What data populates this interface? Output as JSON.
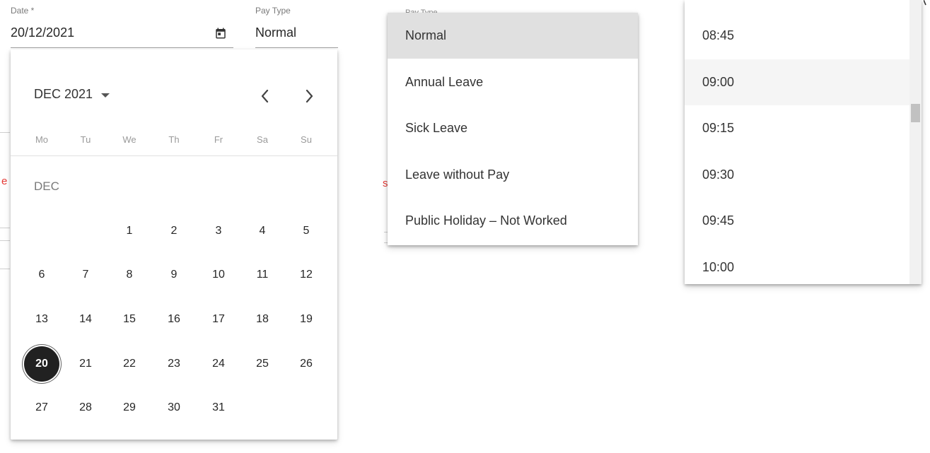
{
  "date_field": {
    "label": "Date *",
    "value": "20/12/2021"
  },
  "pay_type_field": {
    "label": "Pay Type",
    "value": "Normal"
  },
  "background_marks": {
    "left_red": "e",
    "mid_red": "s"
  },
  "calendar": {
    "month_year": "DEC 2021",
    "month_label": "DEC",
    "weekdays": [
      "Mo",
      "Tu",
      "We",
      "Th",
      "Fr",
      "Sa",
      "Su"
    ],
    "weeks": [
      [
        "",
        "",
        "1",
        "2",
        "3",
        "4",
        "5"
      ],
      [
        "6",
        "7",
        "8",
        "9",
        "10",
        "11",
        "12"
      ],
      [
        "13",
        "14",
        "15",
        "16",
        "17",
        "18",
        "19"
      ],
      [
        "20",
        "21",
        "22",
        "23",
        "24",
        "25",
        "26"
      ],
      [
        "27",
        "28",
        "29",
        "30",
        "31",
        "",
        ""
      ]
    ],
    "selected_day": "20",
    "prev_icon": "chevron-left-icon",
    "next_icon": "chevron-right-icon",
    "dropdown_icon": "triangle-down-icon"
  },
  "pay_type_dropdown": {
    "partial_label": "Pay Type",
    "options": [
      "Normal",
      "Annual Leave",
      "Sick Leave",
      "Leave without Pay",
      "Public Holiday – Not Worked"
    ],
    "active_index": 0
  },
  "time_list": {
    "items": [
      "08:45",
      "09:00",
      "09:15",
      "09:30",
      "09:45",
      "10:00"
    ],
    "hovered_index": 1
  },
  "colors": {
    "selected_day_bg": "#212121",
    "option_active_bg": "#e0e0e0",
    "required_red": "#e53935"
  }
}
